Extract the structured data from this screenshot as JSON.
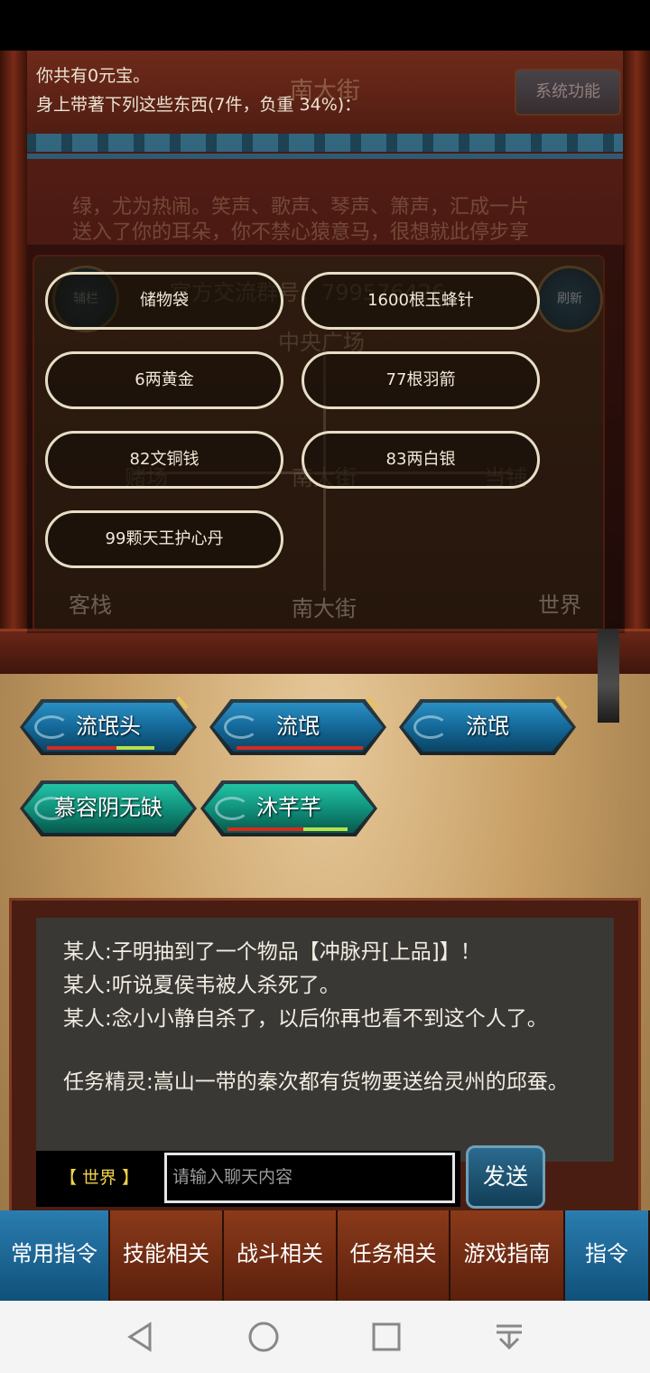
{
  "scene": {
    "title": "南大街",
    "system_button": "系统功能",
    "description_lines": [
      "绿，尤为热闹。笑声、歌声、琴声、箫声，汇成一片",
      "送入了你的耳朵，你不禁心猿意马，很想就此停步享"
    ],
    "qq_group": "官方交流群号：799576426",
    "map_labels": {
      "side_left": "辅栏",
      "side_right": "刷新",
      "center": "中央广场",
      "left": "赌场",
      "middle": "南大街",
      "right": "当铺",
      "bottom_left": "客栈",
      "bottom_middle": "南大街",
      "bottom_right": "世界"
    }
  },
  "inventory": {
    "money_line": "你共有0元宝。",
    "carry_line": "身上带著下列这些东西(7件，负重 34%)：",
    "items": [
      "储物袋",
      "1600根玉蜂针",
      "6两黄金",
      "77根羽箭",
      "82文铜钱",
      "83两白银",
      "99颗天王护心丹"
    ]
  },
  "npcs": [
    {
      "name": "流氓头",
      "style": "blue",
      "hp": 0.55,
      "mp": 0.3
    },
    {
      "name": "流氓",
      "style": "blue",
      "hp": 1.0,
      "mp": 0
    },
    {
      "name": "流氓",
      "style": "blue",
      "hp": 0,
      "mp": 0
    },
    {
      "name": "慕容阴无缺",
      "style": "green",
      "hp": 0,
      "mp": 0
    },
    {
      "name": "沐芊芊",
      "style": "green",
      "hp": 0.6,
      "mp": 0.35
    }
  ],
  "chat": {
    "messages": [
      "某人:子明抽到了一个物品【冲脉丹[上品]】！",
      "某人:听说夏侯韦被人杀死了。",
      "某人:念小小静自杀了，以后你再也看不到这个人了。",
      "任务精灵:嵩山一带的秦次都有货物要送给灵州的邱蚕。"
    ],
    "channel": "【 世界 】",
    "input_placeholder": "请输入聊天内容",
    "send_label": "发送"
  },
  "commands": [
    "常用指令",
    "技能相关",
    "战斗相关",
    "任务相关",
    "游戏指南",
    "指令"
  ],
  "colors": {
    "hp": "#d42a1f",
    "mp": "#b8e04a",
    "accent_blue": "#1a6f9e",
    "accent_green": "#14a088"
  }
}
